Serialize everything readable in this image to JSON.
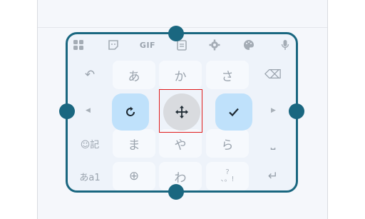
{
  "toolbar": {
    "icons": [
      "apps-grid-icon",
      "sticker-icon",
      "gif-icon",
      "clipboard-icon",
      "settings-gear-icon",
      "palette-icon",
      "microphone-icon"
    ],
    "gif_label": "GIF"
  },
  "keys": {
    "row1": {
      "undo": "↶",
      "a": "あ",
      "ka": "か",
      "sa": "さ",
      "backspace": "⌫"
    },
    "row2": {
      "left": "◀",
      "right": "▶"
    },
    "row3": {
      "emoji_kigou": "☺記",
      "ma": "ま",
      "ya": "や",
      "ra": "ら",
      "space": "⎵"
    },
    "row4": {
      "mode": "あa1",
      "globe": "⊕",
      "wa": "わ",
      "punct": "?\n、。!",
      "enter": "↵"
    }
  },
  "controls": {
    "reset_symbol": "⟳",
    "move_symbol": "✥",
    "done_symbol": "✓"
  },
  "colors": {
    "frame_border": "#1a6780",
    "control_blue": "#bfe1fb",
    "move_gray": "#d9dbdf",
    "highlight_red": "#e01b1b"
  }
}
